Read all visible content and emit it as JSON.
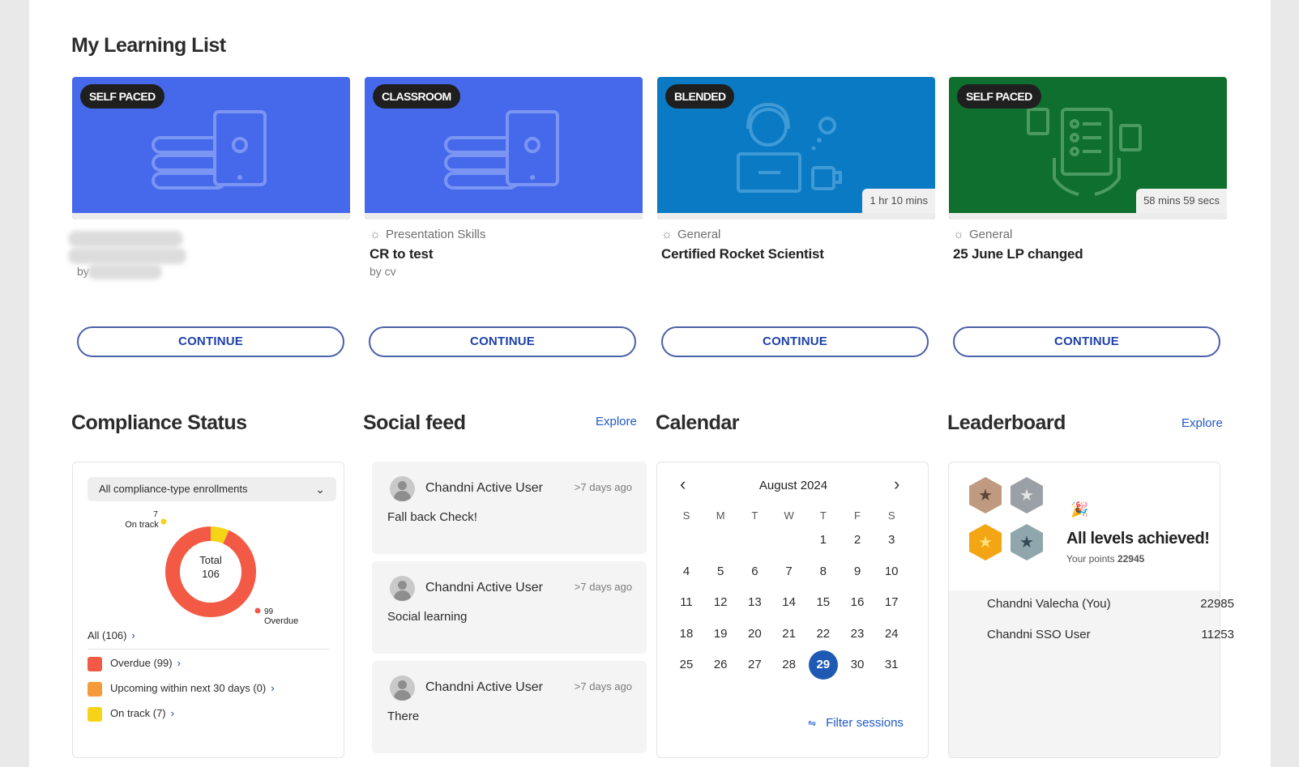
{
  "learning_list": {
    "title": "My Learning List",
    "cards": [
      {
        "badge": "SELF PACED",
        "color": "#4669ec",
        "duration": "",
        "category": "",
        "title": "",
        "by": "by",
        "continue": "CONTINUE"
      },
      {
        "badge": "CLASSROOM",
        "color": "#4669ec",
        "duration": "",
        "category": "Presentation Skills",
        "title": "CR to test",
        "by": "by cv",
        "continue": "CONTINUE"
      },
      {
        "badge": "BLENDED",
        "color": "#0a7ac4",
        "duration": "1 hr 10 mins",
        "category": "General",
        "title": "Certified Rocket Scientist",
        "by": "",
        "continue": "CONTINUE"
      },
      {
        "badge": "SELF PACED",
        "color": "#0f6f2e",
        "duration": "58 mins 59 secs",
        "category": "General",
        "title": "25 June LP changed",
        "by": "",
        "continue": "CONTINUE"
      }
    ]
  },
  "compliance": {
    "title": "Compliance Status",
    "dropdown": "All compliance-type enrollments",
    "donut": {
      "total_label": "Total",
      "total": "106",
      "on_track_count": "7",
      "on_track_label": "On track",
      "overdue_count": "99",
      "overdue_label": "Overdue"
    },
    "chart_data": {
      "type": "pie",
      "categories": [
        "Overdue",
        "On track"
      ],
      "values": [
        99,
        7
      ],
      "colors": [
        "#f25a46",
        "#f5d316"
      ]
    },
    "all_link": "All (106)",
    "legend": [
      {
        "label": "Overdue (99)",
        "color": "#f25a46"
      },
      {
        "label": "Upcoming within next 30 days (0)",
        "color": "#f59a3a"
      },
      {
        "label": "On track (7)",
        "color": "#f5d316"
      }
    ]
  },
  "social": {
    "title": "Social feed",
    "explore": "Explore",
    "items": [
      {
        "name": "Chandni Active User",
        "time": ">7 days ago",
        "message": "Fall back Check!"
      },
      {
        "name": "Chandni Active User",
        "time": ">7 days ago",
        "message": "Social learning"
      },
      {
        "name": "Chandni Active User",
        "time": ">7 days ago",
        "message": "There"
      }
    ]
  },
  "calendar": {
    "title": "Calendar",
    "month": "August 2024",
    "prev": "‹",
    "next": "›",
    "weekdays": [
      "S",
      "M",
      "T",
      "W",
      "T",
      "F",
      "S"
    ],
    "first_weekday": 4,
    "days_in_month": 31,
    "selected_day": 29,
    "filter": "Filter sessions"
  },
  "leaderboard": {
    "title": "Leaderboard",
    "explore": "Explore",
    "achieved": "All levels achieved!",
    "points_label": "Your points",
    "points": "22945",
    "rows": [
      {
        "name": "Chandni Valecha (You)",
        "points": "22985"
      },
      {
        "name": "Chandni SSO User",
        "points": "11253"
      }
    ]
  }
}
